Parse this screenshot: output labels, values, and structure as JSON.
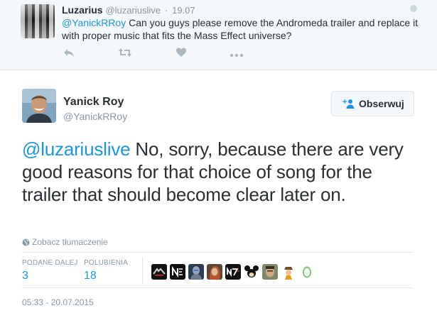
{
  "parent_tweet": {
    "name": "Luzarius",
    "handle": "@luzariuslive",
    "separator": "·",
    "time": "19.07",
    "mention": "@YanickRRoy",
    "text": " Can you guys please remove the Andromeda trailer and replace it with proper music that fits the Mass Effect universe?",
    "actions": [
      "reply-icon",
      "retweet-icon",
      "like-icon",
      "more-icon"
    ]
  },
  "main_tweet": {
    "name": "Yanick Roy",
    "handle": "@YanickRRoy",
    "follow_label": "Obserwuj",
    "mention": "@luzariuslive",
    "text": " No, sorry, because there are very good reasons for that choice of song for the trailer that should become clear later on.",
    "translate_label": "Zobacz tłumaczenie",
    "stats": {
      "retweets_label": "PODANE DALEJ",
      "retweets": "3",
      "likes_label": "POLUBIENIA",
      "likes": "18"
    },
    "timestamp": "05:33 - 20.07.2015"
  },
  "colors": {
    "link": "#1b95e0",
    "muted": "#8899a6",
    "text": "#292f33",
    "parent_bg": "#f5f8fa",
    "border": "#e1e8ed",
    "action_icon": "#aab8c2"
  },
  "likers": [
    {
      "icon": "liker-avatar-dark-logo"
    },
    {
      "icon": "liker-avatar-n-logo"
    },
    {
      "icon": "liker-avatar-armor"
    },
    {
      "icon": "liker-avatar-redhead"
    },
    {
      "icon": "liker-avatar-n7"
    },
    {
      "icon": "liker-avatar-mickey"
    },
    {
      "icon": "liker-avatar-face"
    },
    {
      "icon": "liker-avatar-cartoon"
    },
    {
      "icon": "liker-avatar-egg"
    }
  ]
}
